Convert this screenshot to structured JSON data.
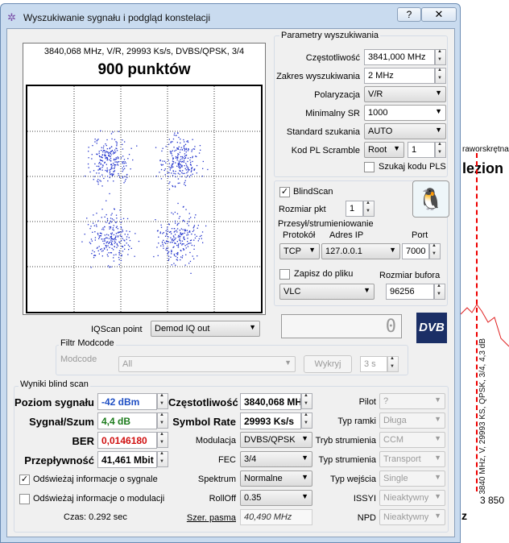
{
  "background": {
    "label_partial": "raworskrętna",
    "label_bold": "lezion",
    "chart_annotation": "3840 MHz, V, 29993 KS, QPSK, 3/4, 4,3 dB",
    "axis_value": "3 850",
    "axis_unit": "z"
  },
  "window": {
    "title": "Wyszukiwanie sygnału i podgląd konstelacji",
    "help_label": "?",
    "close_label": "✕"
  },
  "scope": {
    "info": "3840,068 MHz, V/R, 29993 Ks/s, DVBS/QPSK, 3/4",
    "title": "900 punktów"
  },
  "search_params": {
    "group_label": "Parametry wyszukiwania",
    "frequency_label": "Częstotliwość",
    "frequency_value": "3841,000 MHz",
    "range_label": "Zakres wyszukiwania",
    "range_value": "2 MHz",
    "polarization_label": "Polaryzacja",
    "polarization_value": "V/R",
    "min_sr_label": "Minimalny SR",
    "min_sr_value": "1000",
    "standard_label": "Standard szukania",
    "standard_value": "AUTO",
    "pls_label": "Kod PL Scramble",
    "pls_mode": "Root",
    "pls_value": "1",
    "search_pls_label": "Szukaj kodu PLS"
  },
  "blindscan": {
    "enabled_label": "BlindScan",
    "step_label": "Rozmiar pkt",
    "step_value": "1"
  },
  "stream": {
    "group_label": "Przesył/strumieniowanie",
    "protocol_label": "Protokół",
    "protocol_value": "TCP",
    "ip_label": "Adres IP",
    "ip_value": "127.0.0.1",
    "port_label": "Port",
    "port_value": "7000",
    "save_label": "Zapisz do pliku",
    "buffer_label": "Rozmiar bufora",
    "player_value": "VLC",
    "buffer_value": "96256"
  },
  "iq": {
    "label": "IQScan point",
    "value": "Demod IQ out",
    "blank_digit": "0"
  },
  "modcode": {
    "group_label": "Filtr Modcode",
    "label": "Modcode",
    "value": "All",
    "exclude_label": "Wykryj",
    "interval_value": "3 s"
  },
  "logo": {
    "text": "DVB"
  },
  "results": {
    "group_label": "Wyniki blind scan",
    "level_label": "Poziom sygnału",
    "level_value": "-42 dBm",
    "snr_label": "Sygnał/Szum",
    "snr_value": "4,4 dB",
    "ber_label": "BER",
    "ber_value": "0,0146180",
    "bitrate_label": "Przepływność",
    "bitrate_value": "41,461 Mbit",
    "frequency_label": "Częstotliwość",
    "frequency_value": "3840,068 MH",
    "symbol_rate_label": "Symbol Rate",
    "symbol_rate_value": "29993 Ks/s",
    "modulation_label": "Modulacja",
    "modulation_value": "DVBS/QPSK",
    "fec_label": "FEC",
    "fec_value": "3/4",
    "spectrum_label": "Spektrum",
    "spectrum_value": "Normalne",
    "rolloff_label": "RollOff",
    "rolloff_value": "0.35",
    "bandwidth_label": "Szer. pasma",
    "bandwidth_value": "40,490 MHz",
    "pilot_label": "Pilot",
    "pilot_value": "?",
    "frame_label": "Typ ramki",
    "frame_value": "Długa",
    "stream_mode_label": "Tryb strumienia",
    "stream_mode_value": "CCM",
    "stream_type_label": "Typ strumienia",
    "stream_type_value": "Transport",
    "input_type_label": "Typ wejścia",
    "input_type_value": "Single",
    "issyi_label": "ISSYI",
    "issyi_value": "Nieaktywny",
    "npd_label": "NPD",
    "npd_value": "Nieaktywny",
    "refresh_signal_label": "Odświeżaj informacje o sygnale",
    "refresh_modulation_label": "Odświeżaj informacje o modulacji",
    "time_label": "Czas: 0.292 sec"
  },
  "colors": {
    "level_value": "#1f4fc4",
    "snr_value": "#1a7a1a",
    "ber_value": "#d01010",
    "constellation_point": "#2233cc"
  }
}
